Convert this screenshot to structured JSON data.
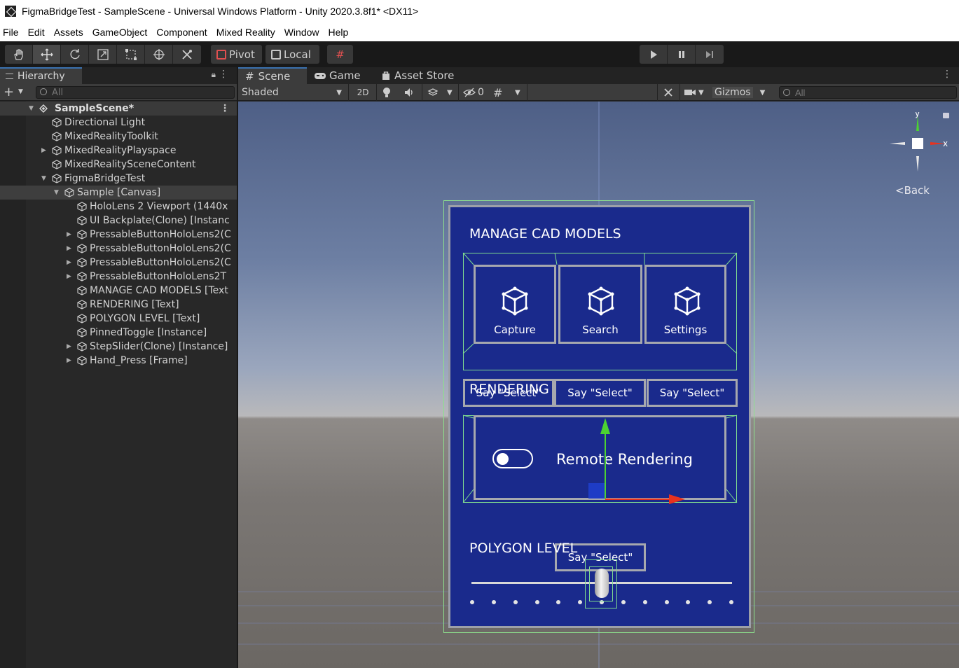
{
  "window": {
    "title": "FigmaBridgeTest - SampleScene - Universal Windows Platform - Unity 2020.3.8f1* <DX11>"
  },
  "menu": [
    "File",
    "Edit",
    "Assets",
    "GameObject",
    "Component",
    "Mixed Reality",
    "Window",
    "Help"
  ],
  "toolbar": {
    "tools": [
      "hand-tool",
      "move-tool",
      "rotate-tool",
      "scale-tool",
      "rect-tool",
      "transform-tool",
      "custom-tool"
    ],
    "active_tool": "move-tool",
    "pivot_label": "Pivot",
    "local_label": "Local"
  },
  "hierarchy": {
    "tab_label": "Hierarchy",
    "search_placeholder": "All",
    "scene_name": "SampleScene*",
    "items": [
      {
        "label": "Directional Light",
        "depth": 1,
        "expand": ""
      },
      {
        "label": "MixedRealityToolkit",
        "depth": 1,
        "expand": ""
      },
      {
        "label": "MixedRealityPlayspace",
        "depth": 1,
        "expand": "collapsed"
      },
      {
        "label": "MixedRealitySceneContent",
        "depth": 1,
        "expand": ""
      },
      {
        "label": "FigmaBridgeTest",
        "depth": 1,
        "expand": "expanded"
      },
      {
        "label": "Sample [Canvas]",
        "depth": 2,
        "expand": "expanded"
      },
      {
        "label": "HoloLens 2 Viewport (1440x",
        "depth": 3,
        "expand": ""
      },
      {
        "label": "UI Backplate(Clone) [Instanc",
        "depth": 3,
        "expand": ""
      },
      {
        "label": "PressableButtonHoloLens2(C",
        "depth": 3,
        "expand": "collapsed"
      },
      {
        "label": "PressableButtonHoloLens2(C",
        "depth": 3,
        "expand": "collapsed"
      },
      {
        "label": "PressableButtonHoloLens2(C",
        "depth": 3,
        "expand": "collapsed"
      },
      {
        "label": "PressableButtonHoloLens2T",
        "depth": 3,
        "expand": "collapsed"
      },
      {
        "label": "MANAGE CAD MODELS [Text",
        "depth": 3,
        "expand": ""
      },
      {
        "label": "RENDERING [Text]",
        "depth": 3,
        "expand": ""
      },
      {
        "label": "POLYGON LEVEL [Text]",
        "depth": 3,
        "expand": ""
      },
      {
        "label": "PinnedToggle [Instance]",
        "depth": 3,
        "expand": ""
      },
      {
        "label": "StepSlider(Clone) [Instance]",
        "depth": 3,
        "expand": "collapsed"
      },
      {
        "label": "Hand_Press [Frame]",
        "depth": 3,
        "expand": "collapsed"
      }
    ],
    "selected_index": 5
  },
  "scene_tabs": [
    {
      "label": "Scene",
      "icon": "grid-icon",
      "active": true
    },
    {
      "label": "Game",
      "icon": "gamepad-icon",
      "active": false
    },
    {
      "label": "Asset Store",
      "icon": "bag-icon",
      "active": false
    }
  ],
  "scene_toolbar": {
    "draw_mode": "Shaded",
    "mode_2d": "2D",
    "hidden_count": "0",
    "gizmos_label": "Gizmos",
    "search_placeholder": "All"
  },
  "gizmo": {
    "y_label": "y",
    "x_label": "x",
    "view_label": "Back"
  },
  "panel": {
    "section1_title": "MANAGE CAD MODELS",
    "buttons": [
      {
        "label": "Capture",
        "voice": "Say \"Select\""
      },
      {
        "label": "Search",
        "voice": "Say \"Select\""
      },
      {
        "label": "Settings",
        "voice": "Say \"Select\""
      }
    ],
    "section2_title": "RENDERING",
    "toggle_label": "Remote Rendering",
    "toggle_on": false,
    "toggle_voice": "Say \"Select\"",
    "section3_title": "POLYGON LEVEL",
    "slider_steps": 13,
    "slider_value_step": 6
  },
  "colors": {
    "panel_blue": "#1a2a8c",
    "selection_green": "#8de08d",
    "axis_x": "#e8321e",
    "axis_y": "#4cd232",
    "accent_tab": "#3a72b0"
  }
}
